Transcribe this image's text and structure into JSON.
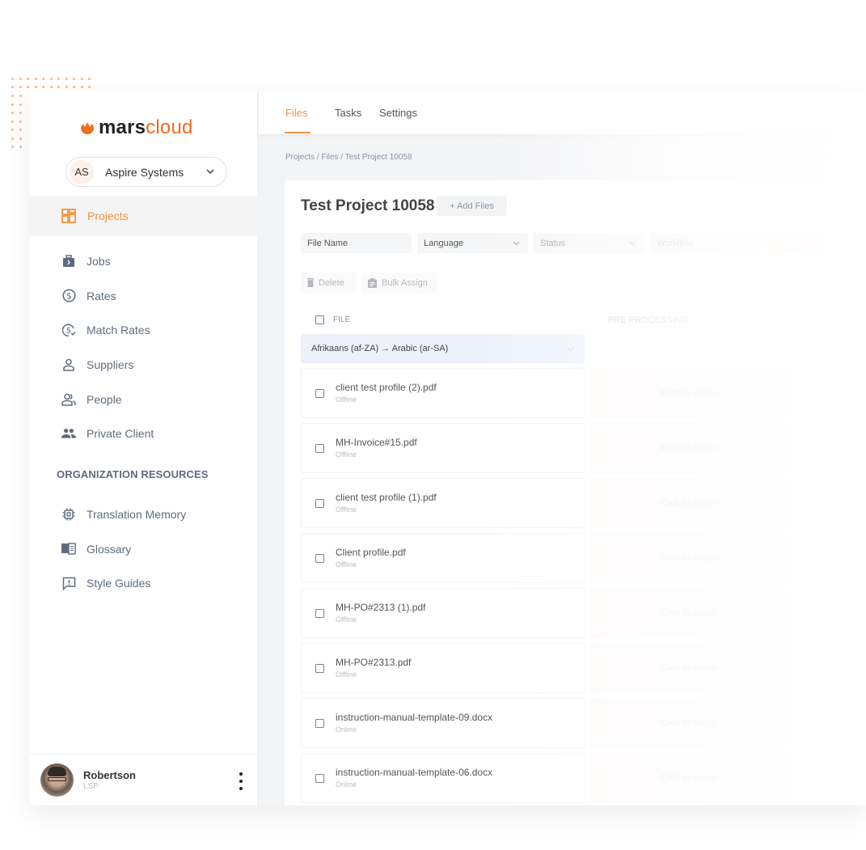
{
  "brand": {
    "name_part1": "mars",
    "name_part2": "cloud",
    "accent": "#f26a1b",
    "nav_accent": "#f7913a"
  },
  "org": {
    "initials": "AS",
    "name": "Aspire Systems"
  },
  "sidebar": {
    "active_item": {
      "label": "Projects",
      "icon": "dashboard-grid-icon"
    },
    "items": [
      {
        "label": "Jobs",
        "icon": "briefcase-icon"
      },
      {
        "label": "Rates",
        "icon": "dollar-circle-icon"
      },
      {
        "label": "Match Rates",
        "icon": "dollar-check-icon"
      },
      {
        "label": "Suppliers",
        "icon": "person-icon"
      },
      {
        "label": "People",
        "icon": "people-icon"
      },
      {
        "label": "Private Client",
        "icon": "group-icon"
      }
    ],
    "section_title": "ORGANIZATION RESOURCES",
    "resources": [
      {
        "label": "Translation Memory",
        "icon": "chip-icon"
      },
      {
        "label": "Glossary",
        "icon": "book-icon"
      },
      {
        "label": "Style Guides",
        "icon": "comment-alert-icon"
      }
    ]
  },
  "user": {
    "name": "Robertson",
    "role": "LSP"
  },
  "tabs": [
    {
      "label": "Files",
      "active": true
    },
    {
      "label": "Tasks",
      "active": false
    },
    {
      "label": "Settings",
      "active": false
    }
  ],
  "breadcrumb": "Projects / Files / Test Project 10058",
  "project": {
    "title": "Test Project 10058",
    "add_files_label": "+ Add Files"
  },
  "filters": {
    "file_name_placeholder": "File Name",
    "language": "Language",
    "status": "Status",
    "workflow": "Workflow",
    "search_label": "Search"
  },
  "actions": {
    "delete_label": "Delete",
    "bulk_assign_label": "Bulk Assign"
  },
  "table": {
    "col_file": "FILE",
    "col_pre": "PRE PROCESSING",
    "language_pair": "Afrikaans (af-ZA) → Arabic (ar-SA)",
    "assign_label": "Click to assign",
    "rows": [
      {
        "name": "client test profile (2).pdf",
        "status": "Offline"
      },
      {
        "name": "MH-Invoice#15.pdf",
        "status": "Offline"
      },
      {
        "name": "client test profile (1).pdf",
        "status": "Offline"
      },
      {
        "name": "Client profile.pdf",
        "status": "Offline"
      },
      {
        "name": "MH-PO#2313 (1).pdf",
        "status": "Offline"
      },
      {
        "name": "MH-PO#2313.pdf",
        "status": "Offline"
      },
      {
        "name": "instruction-manual-template-09.docx",
        "status": "Online"
      },
      {
        "name": "instruction-manual-template-06.docx",
        "status": "Online"
      }
    ]
  }
}
